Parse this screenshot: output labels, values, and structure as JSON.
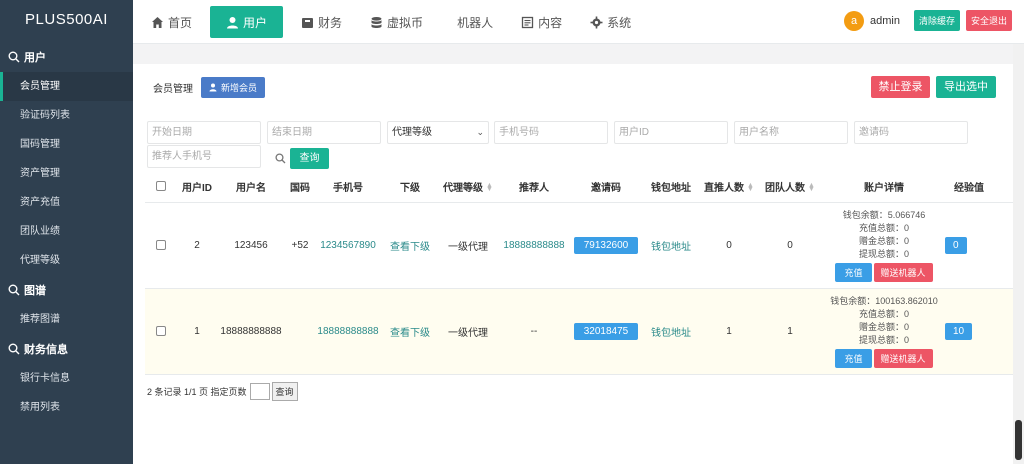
{
  "brand": "PLUS500AI",
  "sidebar": {
    "groups": [
      {
        "title": "用户",
        "items": [
          "会员管理",
          "验证码列表",
          "国码管理",
          "资产管理",
          "资产充值",
          "团队业绩",
          "代理等级"
        ]
      },
      {
        "title": "图谱",
        "items": [
          "推荐图谱"
        ]
      },
      {
        "title": "财务信息",
        "items": [
          "银行卡信息",
          "禁用列表"
        ]
      }
    ]
  },
  "nav": {
    "items": [
      {
        "label": "首页",
        "icon": "home-icon"
      },
      {
        "label": "用户",
        "icon": "user-icon"
      },
      {
        "label": "财务",
        "icon": "wallet-icon"
      },
      {
        "label": "虚拟币",
        "icon": "database-icon"
      },
      {
        "label": "机器人",
        "icon": ""
      },
      {
        "label": "内容",
        "icon": "document-icon"
      },
      {
        "label": "系统",
        "icon": "gear-icon"
      }
    ],
    "active": "用户"
  },
  "user": {
    "avatar_letter": "a",
    "name": "admin",
    "clear_cache": "清除缓存",
    "logout": "安全退出"
  },
  "page": {
    "title": "会员管理",
    "add_button": "新增会员",
    "ban_login": "禁止登录",
    "export": "导出选中"
  },
  "filters": {
    "start_date": "开始日期",
    "end_date": "结束日期",
    "agent_level": "代理等级",
    "phone": "手机号码",
    "user_id": "用户ID",
    "username": "用户名称",
    "invite_code": "邀请码",
    "referrer_phone": "推荐人手机号",
    "query": "查询"
  },
  "table": {
    "headers": {
      "user_id": "用户ID",
      "username": "用户名",
      "country_code": "国码",
      "phone": "手机号",
      "downline": "下级",
      "agent_level": "代理等级",
      "referrer": "推荐人",
      "invite_code": "邀请码",
      "wallet": "钱包地址",
      "direct_count": "直推人数",
      "team_count": "团队人数",
      "account_detail": "账户详情",
      "experience": "经验值"
    },
    "rows": [
      {
        "user_id": "2",
        "username": "123456",
        "country_code": "+52",
        "phone": "1234567890",
        "downline": "查看下级",
        "agent_level": "一级代理",
        "referrer": "18888888888",
        "invite_code": "79132600",
        "wallet": "钱包地址",
        "direct_count": "0",
        "team_count": "0",
        "balance": "钱包余额：5.066746",
        "recharge": "充值总额：0",
        "gift": "赠金总额：0",
        "withdraw": "提现总额：0",
        "recharge_btn": "充值",
        "gift_robot_btn": "赠送机器人",
        "experience": "0"
      },
      {
        "user_id": "1",
        "username": "18888888888",
        "country_code": "",
        "phone": "18888888888",
        "downline": "查看下级",
        "agent_level": "一级代理",
        "referrer": "--",
        "invite_code": "32018475",
        "wallet": "钱包地址",
        "direct_count": "1",
        "team_count": "1",
        "balance": "钱包余额：100163.862010",
        "recharge": "充值总额：0",
        "gift": "赠金总额：0",
        "withdraw": "提现总额：0",
        "recharge_btn": "充值",
        "gift_robot_btn": "赠送机器人",
        "experience": "10"
      }
    ]
  },
  "pager": {
    "summary": "2 条记录 1/1 页 指定页数",
    "go": "查询"
  },
  "colors": {
    "sidebar": "#2f4050",
    "accent": "#1ab394",
    "danger": "#ed5565",
    "primary": "#3a9ee6"
  }
}
